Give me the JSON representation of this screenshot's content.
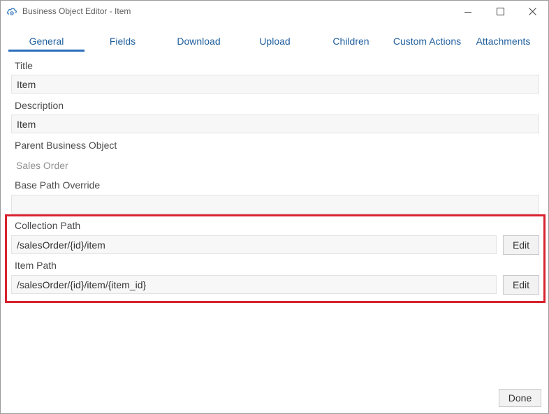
{
  "window": {
    "title": "Business Object Editor - Item",
    "icons": [
      "cloud-gear-icon",
      "minimize-icon",
      "maximize-icon",
      "close-icon"
    ]
  },
  "tabs": [
    {
      "label": "General",
      "active": true
    },
    {
      "label": "Fields"
    },
    {
      "label": "Download"
    },
    {
      "label": "Upload"
    },
    {
      "label": "Children"
    },
    {
      "label": "Custom Actions"
    },
    {
      "label": "Attachments"
    }
  ],
  "form": {
    "title_label": "Title",
    "title_value": "Item",
    "description_label": "Description",
    "description_value": "Item",
    "parent_label": "Parent Business Object",
    "parent_value": "Sales Order",
    "base_path_label": "Base Path Override",
    "base_path_value": "",
    "collection_path_label": "Collection Path",
    "collection_path_value": "/salesOrder/{id}/item",
    "collection_edit_label": "Edit",
    "item_path_label": "Item Path",
    "item_path_value": "/salesOrder/{id}/item/{item_id}",
    "item_edit_label": "Edit"
  },
  "footer": {
    "done_label": "Done"
  },
  "colors": {
    "accent": "#2a6ebb",
    "highlight": "#d7232f"
  }
}
